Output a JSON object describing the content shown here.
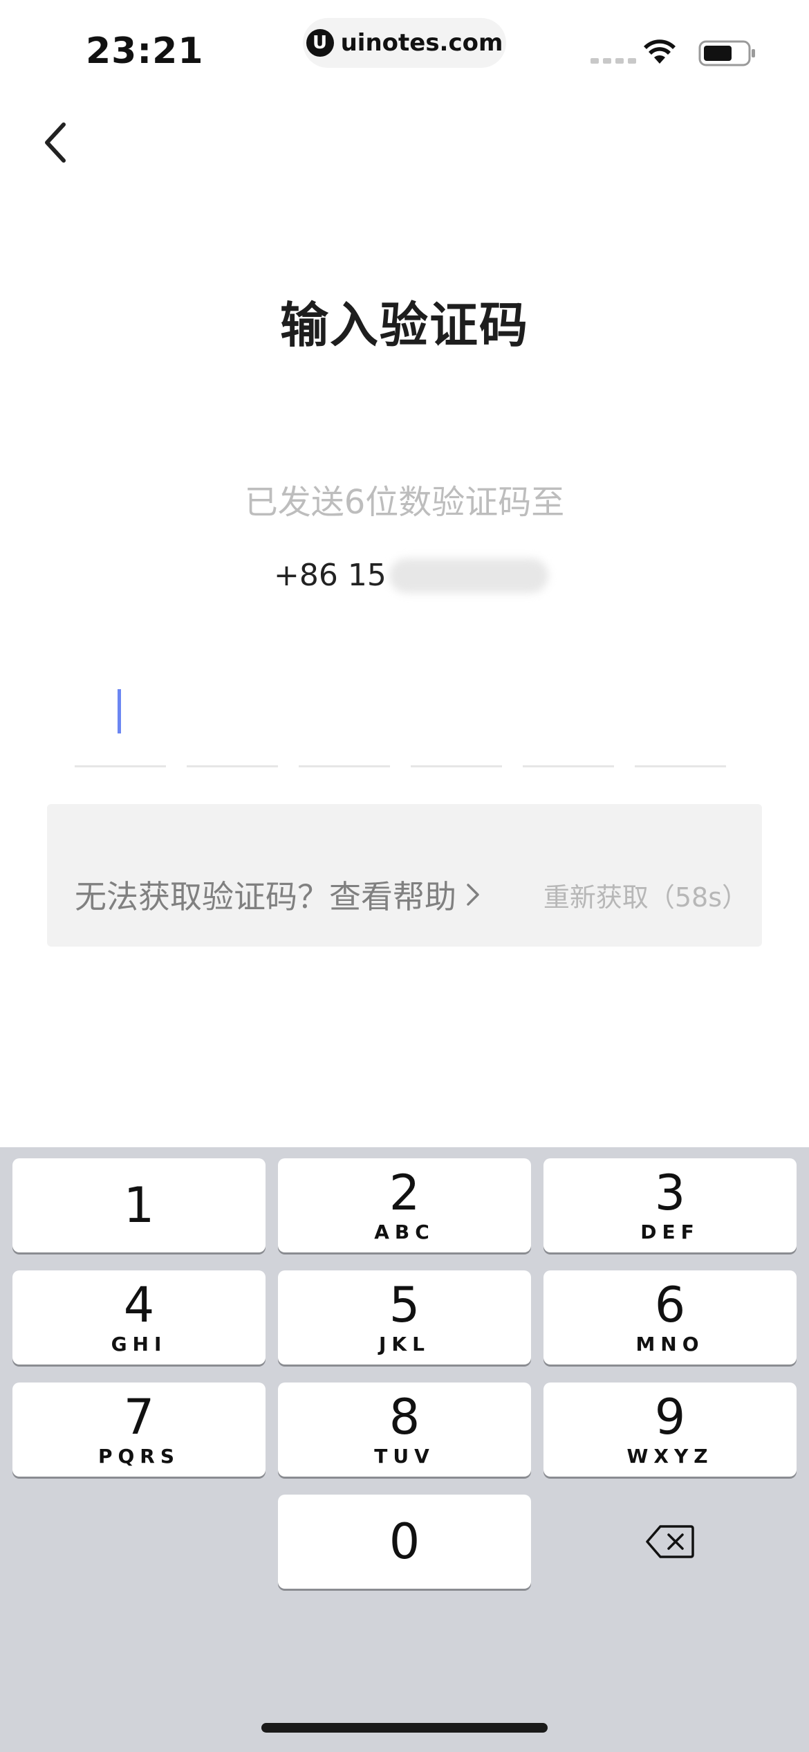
{
  "status_bar": {
    "time": "23:21",
    "url": "uinotes.com",
    "url_logo": "U"
  },
  "header": {
    "back_icon": "chevron-left-icon"
  },
  "main": {
    "title": "输入验证码",
    "subtitle": "已发送6位数验证码至",
    "phone_visible": "+86 15",
    "code_length": 6
  },
  "help": {
    "link_text": "无法获取验证码？查看帮助",
    "resend_text": "重新获取（58s）"
  },
  "keyboard": {
    "keys": [
      {
        "num": "1",
        "letters": ""
      },
      {
        "num": "2",
        "letters": "ABC"
      },
      {
        "num": "3",
        "letters": "DEF"
      },
      {
        "num": "4",
        "letters": "GHI"
      },
      {
        "num": "5",
        "letters": "JKL"
      },
      {
        "num": "6",
        "letters": "MNO"
      },
      {
        "num": "7",
        "letters": "PQRS"
      },
      {
        "num": "8",
        "letters": "TUV"
      },
      {
        "num": "9",
        "letters": "WXYZ"
      },
      {
        "num": "0",
        "letters": ""
      }
    ],
    "delete_icon": "backspace-icon"
  },
  "colors": {
    "accent_cursor": "#6b86f2",
    "keyboard_bg": "#d1d3d9",
    "help_bg": "#f2f2f2"
  }
}
